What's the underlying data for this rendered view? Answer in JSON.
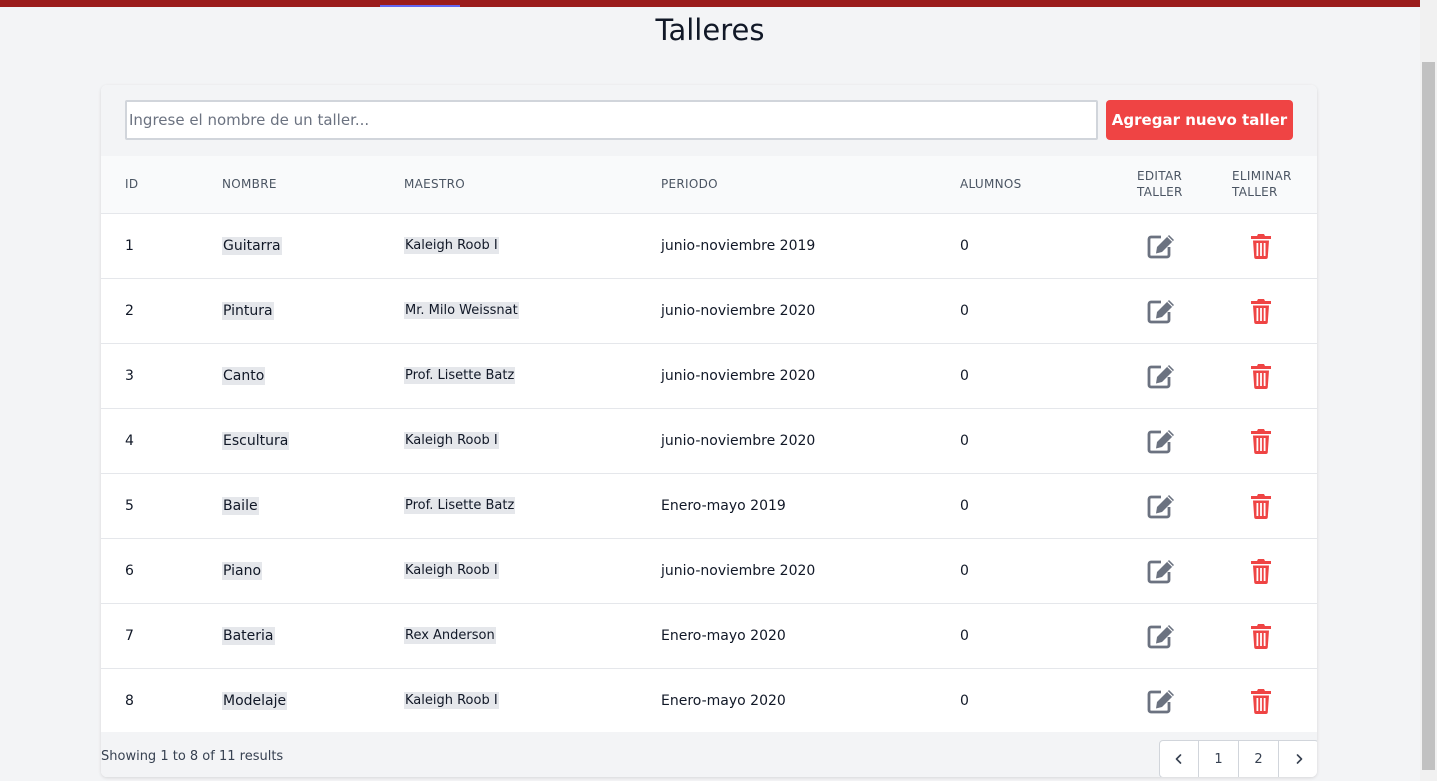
{
  "page": {
    "title": "Talleres"
  },
  "toolbar": {
    "search_placeholder": "Ingrese el nombre de un taller...",
    "search_value": "",
    "add_label": "Agregar nuevo taller"
  },
  "table": {
    "headers": {
      "id": "ID",
      "nombre": "NOMBRE",
      "maestro": "MAESTRO",
      "periodo": "PERIODO",
      "alumnos": "ALUMNOS",
      "editar_1": "EDITAR",
      "editar_2": "TALLER",
      "eliminar_1": "ELIMINAR",
      "eliminar_2": "TALLER"
    },
    "rows": [
      {
        "id": "1",
        "nombre": "Guitarra",
        "maestro": "Kaleigh Roob I",
        "periodo": "junio-noviembre 2019",
        "alumnos": "0"
      },
      {
        "id": "2",
        "nombre": "Pintura",
        "maestro": "Mr. Milo Weissnat",
        "periodo": "junio-noviembre 2020",
        "alumnos": "0"
      },
      {
        "id": "3",
        "nombre": "Canto",
        "maestro": "Prof. Lisette Batz",
        "periodo": "junio-noviembre 2020",
        "alumnos": "0"
      },
      {
        "id": "4",
        "nombre": "Escultura",
        "maestro": "Kaleigh Roob I",
        "periodo": "junio-noviembre 2020",
        "alumnos": "0"
      },
      {
        "id": "5",
        "nombre": "Baile",
        "maestro": "Prof. Lisette Batz",
        "periodo": "Enero-mayo 2019",
        "alumnos": "0"
      },
      {
        "id": "6",
        "nombre": "Piano",
        "maestro": "Kaleigh Roob I",
        "periodo": "junio-noviembre 2020",
        "alumnos": "0"
      },
      {
        "id": "7",
        "nombre": "Bateria",
        "maestro": "Rex Anderson",
        "periodo": "Enero-mayo 2020",
        "alumnos": "0"
      },
      {
        "id": "8",
        "nombre": "Modelaje",
        "maestro": "Kaleigh Roob I",
        "periodo": "Enero-mayo 2020",
        "alumnos": "0"
      }
    ]
  },
  "footer": {
    "results_text": "Showing 1 to 8 of 11 results",
    "pages": [
      "1",
      "2"
    ]
  },
  "icons": {
    "edit": "edit-icon",
    "delete": "trash-icon",
    "prev": "chevron-left-icon",
    "next": "chevron-right-icon"
  },
  "colors": {
    "accent": "#ef4444",
    "topbar": "#9b1c1c",
    "edit_icon": "#6b7280",
    "delete_icon": "#ef4444"
  }
}
